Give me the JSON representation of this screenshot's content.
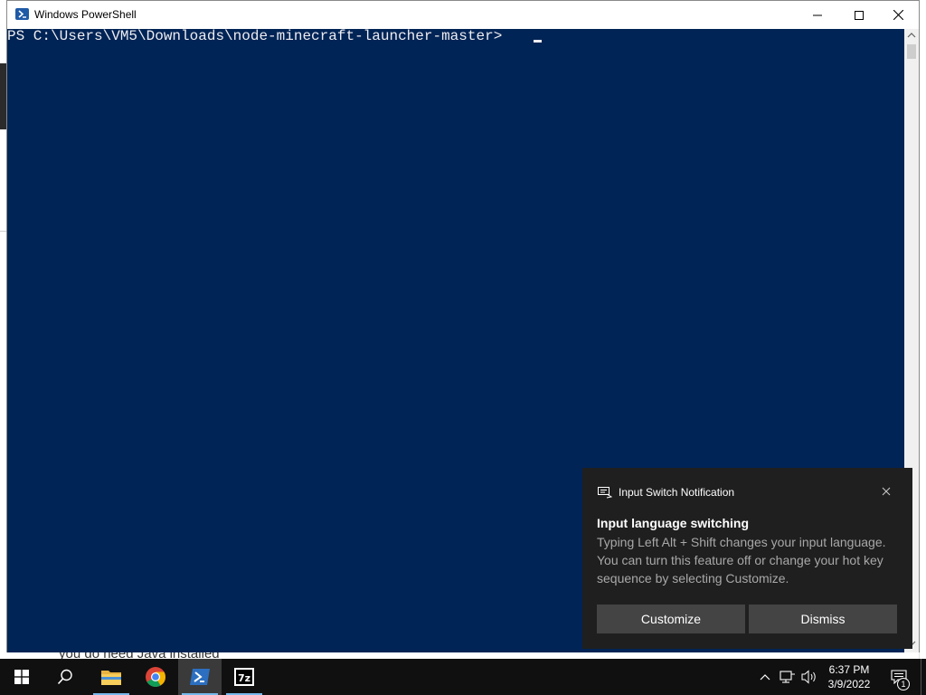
{
  "background_window": {
    "partial_text": "you do need Java installed"
  },
  "powershell": {
    "title": "Windows PowerShell",
    "prompt": "PS C:\\Users\\VM5\\Downloads\\node-minecraft-launcher-master> ",
    "background_color": "#012456",
    "text_color": "#eeedf0"
  },
  "toast": {
    "app_name": "Input Switch Notification",
    "title": "Input language switching",
    "body": "Typing Left Alt + Shift changes your input language. You can turn this feature off or change your hot key sequence by selecting Customize.",
    "buttons": {
      "customize": "Customize",
      "dismiss": "Dismiss"
    }
  },
  "taskbar": {
    "apps": [
      {
        "name": "start",
        "icon": "windows-logo-icon"
      },
      {
        "name": "search",
        "icon": "search-icon"
      },
      {
        "name": "file-explorer",
        "icon": "folder-icon"
      },
      {
        "name": "chrome",
        "icon": "chrome-icon"
      },
      {
        "name": "powershell",
        "icon": "powershell-icon",
        "active": true
      },
      {
        "name": "7-zip",
        "icon": "7zip-icon"
      }
    ],
    "clock": {
      "time": "6:37 PM",
      "date": "3/9/2022"
    },
    "notification_count": "1"
  }
}
